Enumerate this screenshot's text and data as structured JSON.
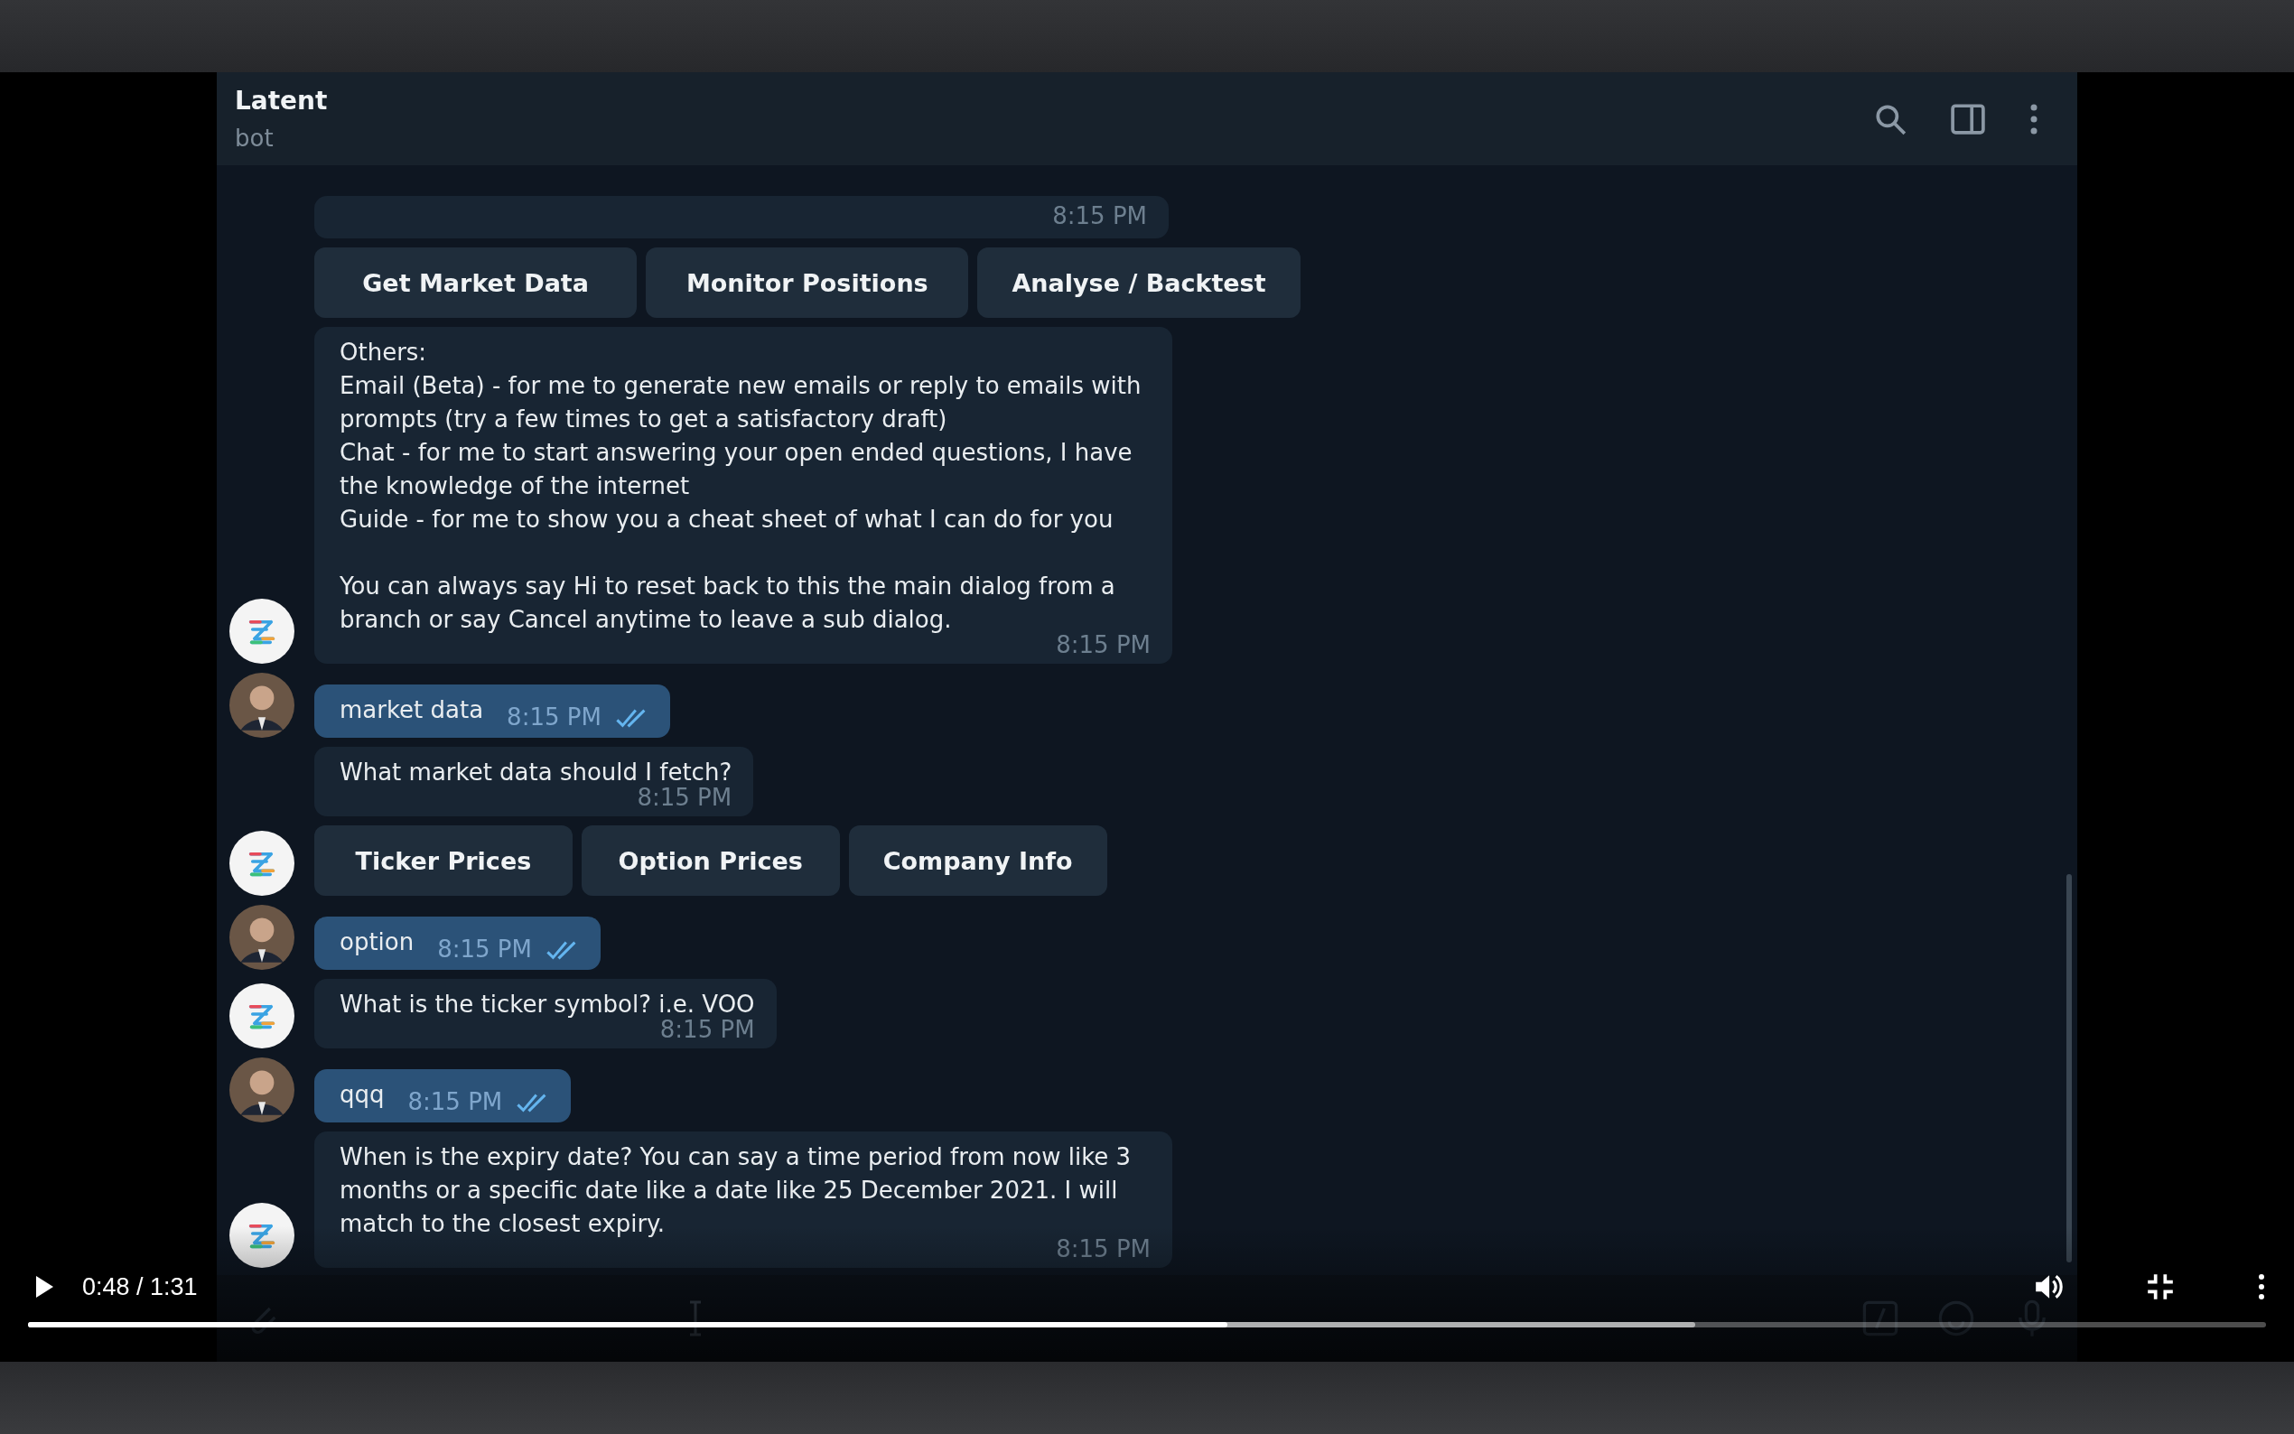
{
  "chat": {
    "title": "Latent",
    "subtitle": "bot"
  },
  "messages": [
    {
      "kind": "bot_tail",
      "time": "8:15 PM",
      "avatar": false
    },
    {
      "kind": "buttons",
      "avatar": false,
      "buttons": [
        "Get Market Data",
        "Monitor Positions",
        "Analyse / Backtest"
      ]
    },
    {
      "kind": "bot",
      "avatar": true,
      "text": "Others:\nEmail (Beta) - for me to generate new emails or reply to emails with prompts (try a few times to get a satisfactory draft)\nChat - for me to start answering your open ended questions, I have the knowledge of the internet\nGuide - for me to show you a cheat sheet of what I can do for you\n\nYou can always say Hi to reset back to this the main dialog from a branch or say Cancel anytime to leave a sub dialog.",
      "time": "8:15 PM"
    },
    {
      "kind": "user",
      "avatar": true,
      "text": "market data",
      "time": "8:15 PM",
      "read": true
    },
    {
      "kind": "bot",
      "avatar": false,
      "text": "What market data should I fetch?",
      "time": "8:15 PM"
    },
    {
      "kind": "buttons",
      "avatar": true,
      "buttons": [
        "Ticker Prices",
        "Option Prices",
        "Company Info"
      ]
    },
    {
      "kind": "user",
      "avatar": true,
      "text": "option",
      "time": "8:15 PM",
      "read": true
    },
    {
      "kind": "bot",
      "avatar": true,
      "text": "What is the ticker symbol? i.e. VOO",
      "time": "8:15 PM"
    },
    {
      "kind": "user",
      "avatar": true,
      "text": "qqq",
      "time": "8:15 PM",
      "read": true
    },
    {
      "kind": "bot",
      "avatar": true,
      "text": "When is the expiry date? You can say a time period from now like 3 months or a specific date like a date like 25 December 2021. I will match to the closest expiry.",
      "time": "8:15 PM"
    }
  ],
  "player": {
    "playing": false,
    "time": "0:48 / 1:31",
    "progress": {
      "level": 0.536
    },
    "buffered": {
      "level": 0.745
    }
  }
}
